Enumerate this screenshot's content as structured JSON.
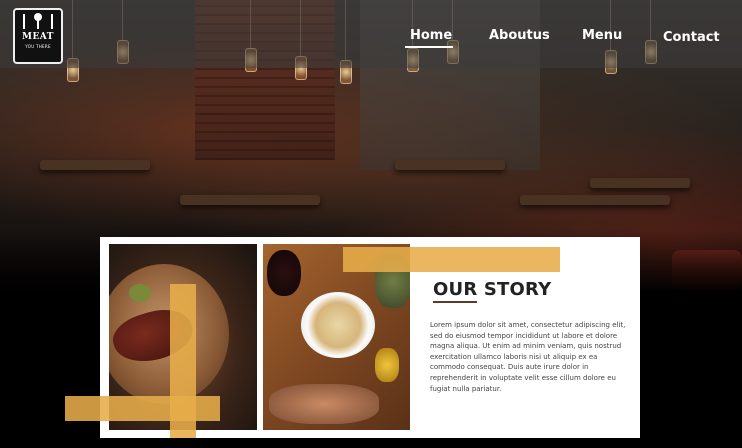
{
  "brand": {
    "logo_title": "MEAT",
    "logo_subtitle": "YOU THERE"
  },
  "nav": {
    "items": [
      {
        "label": "Home",
        "active": true
      },
      {
        "label": "Aboutus",
        "active": false
      },
      {
        "label": "Menu",
        "active": false
      },
      {
        "label": "Contact",
        "active": false
      }
    ]
  },
  "story": {
    "title": "OUR STORY",
    "body": "Lorem ipsum dolor sit amet, consectetur adipiscing elit, sed do eiusmod tempor incididunt ut labore et dolore magna aliqua. Ut enim ad minim veniam, quis nostrud exercitation ullamco laboris nisi ut aliquip ex ea commodo consequat. Duis aute irure dolor in reprehenderit in voluptate velit esse cillum dolore eu fugiat nulla pariatur."
  },
  "colors": {
    "accent_gold": "#e7ad4a",
    "nav_text": "#ffffff",
    "card_background": "#ffffff",
    "page_background": "#000000"
  },
  "icons": {
    "logo": "chef-knife-fork-icon"
  }
}
